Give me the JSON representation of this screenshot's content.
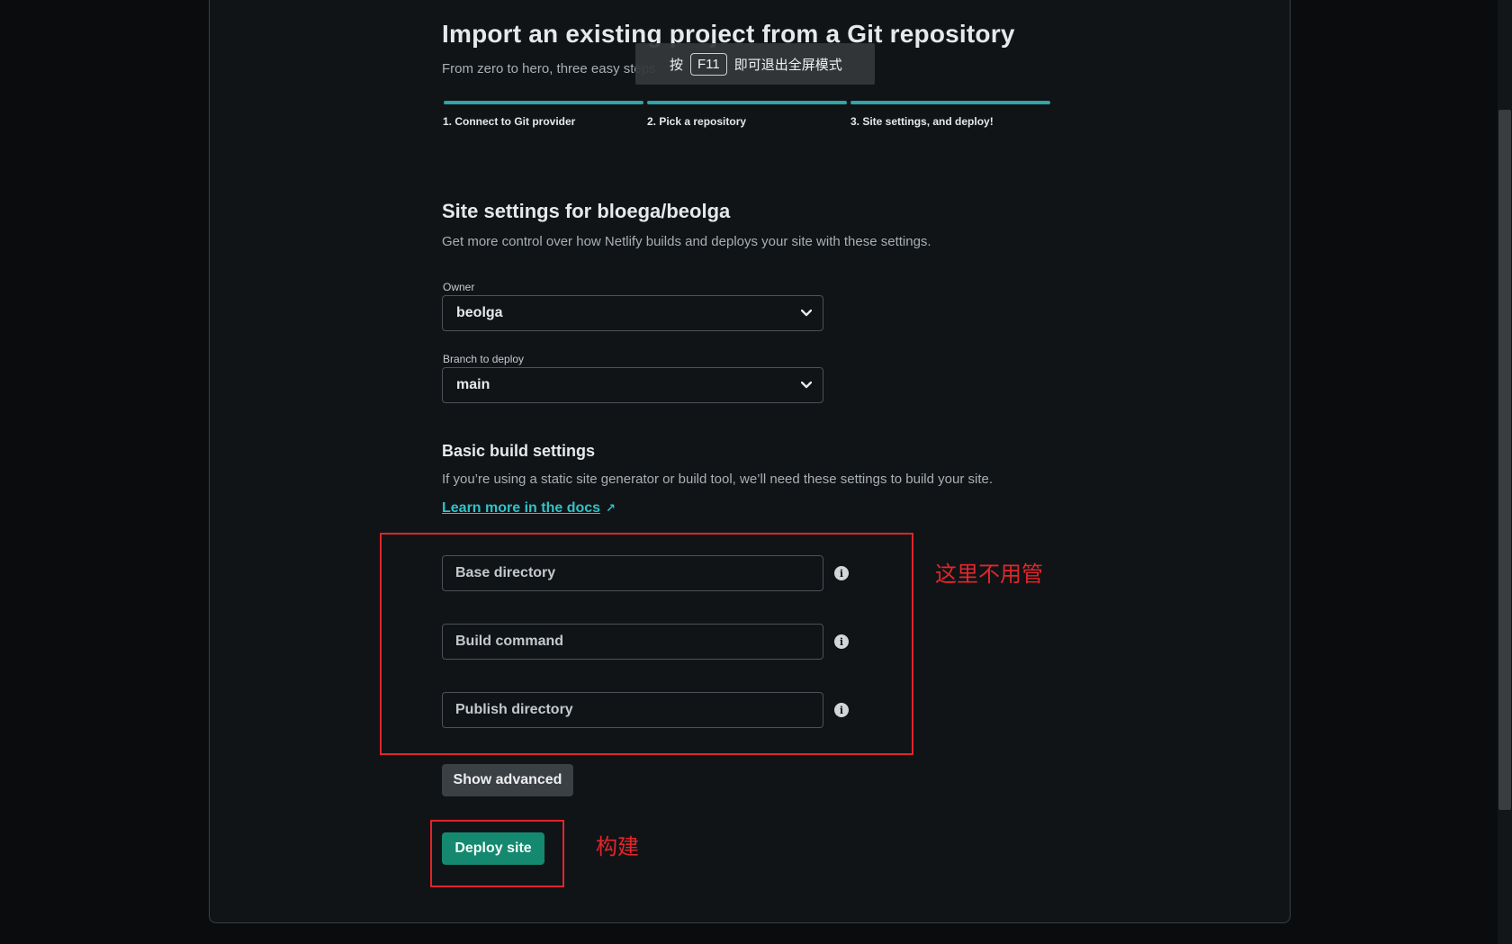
{
  "header": {
    "title": "Import an existing project from a Git repository",
    "subtitle": "From zero to hero, three easy steps"
  },
  "fullscreen_toast": {
    "prefix": "按",
    "key": "F11",
    "suffix": "即可退出全屏模式"
  },
  "steps": [
    {
      "label": "1. Connect to Git provider",
      "complete": true
    },
    {
      "label": "2. Pick a repository",
      "complete": true
    },
    {
      "label": "3. Site settings, and deploy!",
      "complete": true
    }
  ],
  "site_settings": {
    "heading": "Site settings for bloega/beolga",
    "description": "Get more control over how Netlify builds and deploys your site with these settings.",
    "owner": {
      "label": "Owner",
      "value": "beolga"
    },
    "branch": {
      "label": "Branch to deploy",
      "value": "main"
    }
  },
  "build_settings": {
    "heading": "Basic build settings",
    "description": "If you’re using a static site generator or build tool, we’ll need these settings to build your site.",
    "docs_link": "Learn more in the docs",
    "base_directory": {
      "placeholder": "Base directory",
      "value": ""
    },
    "build_command": {
      "placeholder": "Build command",
      "value": ""
    },
    "publish_directory": {
      "placeholder": "Publish directory",
      "value": ""
    }
  },
  "buttons": {
    "show_advanced": "Show advanced",
    "deploy_site": "Deploy site"
  },
  "annotations": {
    "fields_note": "这里不用管",
    "deploy_note": "构建",
    "color": "#e0242a"
  },
  "colors": {
    "accent_teal": "#30a5a8",
    "link": "#32c2c6",
    "deploy_button": "#14896f",
    "background": "#101417"
  },
  "icons": [
    "chevron-down-icon",
    "info-icon",
    "external-link-icon"
  ]
}
